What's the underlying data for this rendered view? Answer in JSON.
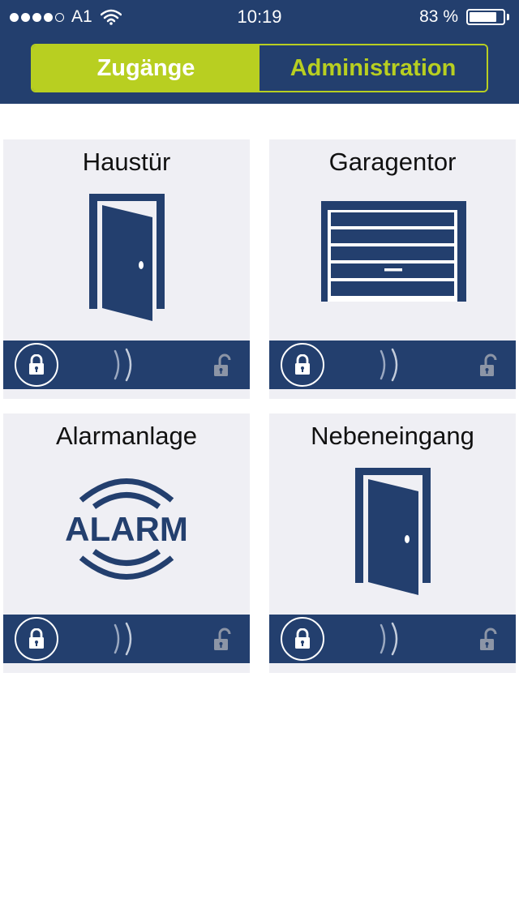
{
  "status_bar": {
    "signal_dots_filled": 4,
    "signal_dots_total": 5,
    "carrier": "A1",
    "time": "10:19",
    "battery": "83 %",
    "battery_level": 0.83
  },
  "tabs": [
    {
      "label": "Zugänge",
      "active": true
    },
    {
      "label": "Administration",
      "active": false
    }
  ],
  "tiles": [
    {
      "title": "Haustür",
      "icon": "door-icon"
    },
    {
      "title": "Garagentor",
      "icon": "garage-door-icon"
    },
    {
      "title": "Alarmanlage",
      "icon": "alarm-icon",
      "icon_text": "ALARM"
    },
    {
      "title": "Nebeneingang",
      "icon": "door-icon"
    }
  ],
  "colors": {
    "header_blue": "#233f6e",
    "accent_green": "#b8cf21",
    "tile_background": "#efeff4"
  }
}
